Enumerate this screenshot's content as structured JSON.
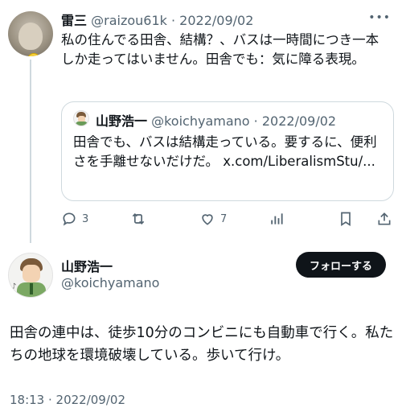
{
  "parent_tweet": {
    "author_name": "雷三",
    "handle": "@raizou61k",
    "separator": "·",
    "date": "2022/09/02",
    "text": "私の住んでる田舎、結構？、バスは一時間につき一本しか走ってはいません。田舎でも：気に障る表現。",
    "quote": {
      "author_name": "山野浩一",
      "handle": "@koichyamano",
      "separator": "·",
      "date": "2022/09/02",
      "text": "田舎でも、バスは結構走っている。要するに、便利さを手離せないだけだ。 x.com/LiberalismStu/..."
    },
    "actions": {
      "reply_count": "3",
      "like_count": "7"
    }
  },
  "main_tweet": {
    "author_name": "山野浩一",
    "handle": "@koichyamano",
    "follow_label": "フォローする",
    "text": "田舎の連中は、徒歩10分のコンビニにも自動車で行く。私たちの地球を環境破壊している。歩いて行け。",
    "timestamp": "18:13 · 2022/09/02"
  },
  "icons": [
    "more-icon",
    "reply-icon",
    "retweet-icon",
    "like-icon",
    "views-icon",
    "bookmark-icon",
    "share-icon"
  ],
  "colors": {
    "text": "#0f1419",
    "muted": "#536471",
    "border": "#cfd9de",
    "button": "#0f1419"
  }
}
